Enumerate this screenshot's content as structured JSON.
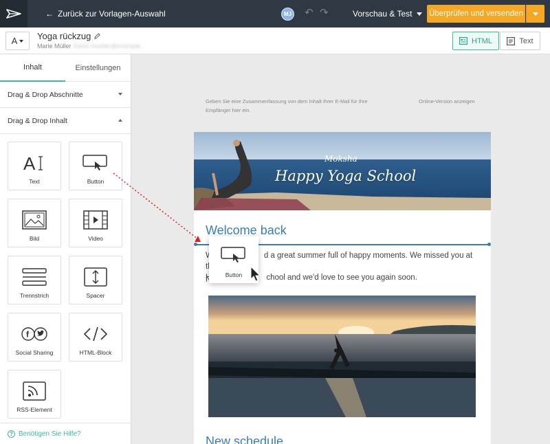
{
  "topbar": {
    "back_label": "Zurück zur Vorlagen-Auswahl",
    "avatar_initials": "MJ",
    "preview_label": "Vorschau & Test",
    "send_label": "Überprüfen und versenden"
  },
  "subheader": {
    "font_button_label": "A",
    "doc_title": "Yoga rückzug",
    "author": "Marie Müller",
    "author_email_blurred": "marie.mueller@example...",
    "view_html_label": "HTML",
    "view_text_label": "Text"
  },
  "sidebar": {
    "tabs": [
      {
        "label": "Inhalt"
      },
      {
        "label": "Einstellungen"
      }
    ],
    "sections": [
      {
        "label": "Drag & Drop Abschnitte"
      },
      {
        "label": "Drag & Drop Inhalt"
      }
    ],
    "tiles": [
      {
        "label": "Text",
        "icon": "text-icon"
      },
      {
        "label": "Button",
        "icon": "button-icon"
      },
      {
        "label": "Bild",
        "icon": "image-icon"
      },
      {
        "label": "Video",
        "icon": "video-icon"
      },
      {
        "label": "Trennstrich",
        "icon": "divider-icon"
      },
      {
        "label": "Spacer",
        "icon": "spacer-icon"
      },
      {
        "label": "Social Sharing",
        "icon": "social-icon"
      },
      {
        "label": "HTML-Block",
        "icon": "code-icon"
      },
      {
        "label": "RSS-Element",
        "icon": "rss-icon"
      }
    ],
    "help_label": "Benötigen Sie Hilfe?"
  },
  "canvas": {
    "preheader": "Geben Sie eine Zusammenfassung von dem Inhalt Ihrer E-Mail für Ihre Empfänger hier ein.",
    "online_version": "Online-Version anzeigen",
    "hero_brand": "Moksha",
    "hero_title": "Happy Yoga School",
    "welcome_heading": "Welcome back",
    "body_text": "We hope you had a great summer full of happy moments. We missed you at the Happy Yoga School and we'd love to see you again soon.",
    "body_text_visible_1": "W",
    "body_text_visible_2": "d a great summer full of happy moments. We missed you at the",
    "body_text_visible_3": "H",
    "body_text_visible_4": "chool and we'd love to see you again soon.",
    "body_n": "N",
    "new_schedule_heading": "New schedule",
    "drag_ghost_label": "Button"
  },
  "colors": {
    "topbar": "#2f3943",
    "accent_orange": "#f5a623",
    "accent_teal": "#3fb6a0",
    "heading_blue": "#3a7cb8"
  }
}
